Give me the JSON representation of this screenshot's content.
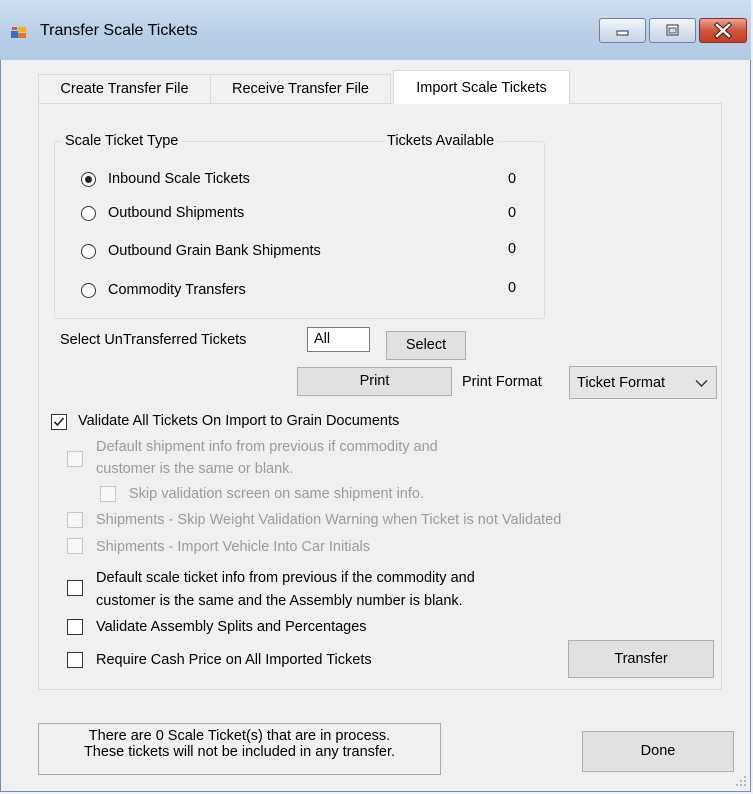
{
  "window": {
    "title": "Transfer Scale Tickets"
  },
  "tabs": [
    {
      "label": "Create Transfer File",
      "active": false
    },
    {
      "label": "Receive Transfer File",
      "active": false
    },
    {
      "label": "Import Scale Tickets",
      "active": true
    }
  ],
  "scale_ticket_type": {
    "legend": "Scale Ticket Type",
    "available_legend": "Tickets Available",
    "options": [
      {
        "label": "Inbound Scale Tickets",
        "selected": true,
        "available": "0"
      },
      {
        "label": "Outbound Shipments",
        "selected": false,
        "available": "0"
      },
      {
        "label": "Outbound Grain Bank Shipments",
        "selected": false,
        "available": "0"
      },
      {
        "label": "Commodity Transfers",
        "selected": false,
        "available": "0"
      }
    ]
  },
  "select_untransferred": {
    "label": "Select UnTransferred Tickets",
    "value": "All",
    "button": "Select"
  },
  "print": {
    "button": "Print",
    "format_label": "Print Format",
    "format_value": "Ticket Format"
  },
  "options": {
    "validate_all": {
      "label": "Validate All Tickets On Import to Grain Documents",
      "checked": true
    },
    "default_shipment": {
      "label_line1": "Default shipment info from previous if commodity and",
      "label_line2": "customer is the same or blank.",
      "checked": false,
      "enabled": false
    },
    "skip_validation": {
      "label": "Skip validation screen on same shipment info.",
      "checked": false,
      "enabled": false
    },
    "skip_weight": {
      "label": "Shipments - Skip Weight Validation Warning when Ticket is not Validated",
      "checked": false,
      "enabled": false
    },
    "import_vehicle": {
      "label": "Shipments - Import Vehicle Into Car Initials",
      "checked": false,
      "enabled": false
    },
    "default_scale": {
      "label_line1": "Default scale ticket info from previous if the commodity and",
      "label_line2": "customer is the same and the Assembly number is blank.",
      "checked": false
    },
    "validate_assembly": {
      "label": "Validate Assembly Splits and Percentages",
      "checked": false
    },
    "require_cash": {
      "label": "Require Cash Price on All Imported Tickets",
      "checked": false
    }
  },
  "transfer_button": "Transfer",
  "status": {
    "line1": "There are 0 Scale Ticket(s) that are in process.",
    "line2": "These tickets will not be included in any transfer."
  },
  "done_button": "Done",
  "icons": {
    "app": "app-grid-icon",
    "minimize": "minimize-icon",
    "maximize": "maximize-icon",
    "close": "close-icon",
    "dropdown": "chevron-down-icon",
    "check": "checkmark-icon",
    "grip": "resize-grip-icon"
  }
}
